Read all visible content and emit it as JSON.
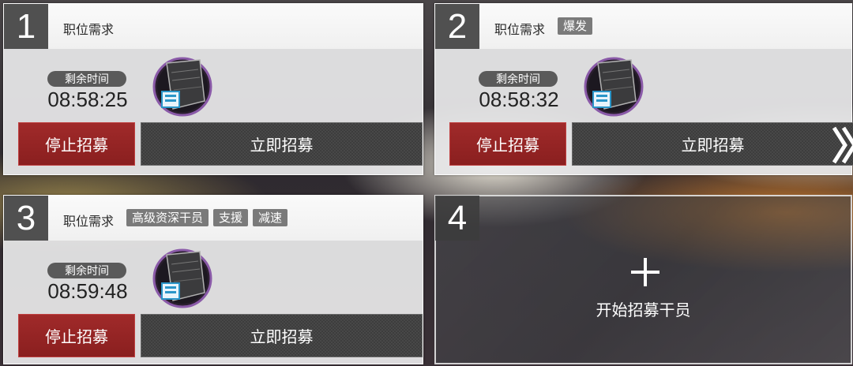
{
  "slots": [
    {
      "number": "1",
      "requirement_label": "职位需求",
      "tags": [],
      "time_label": "剩余时间",
      "time_remaining": "08:58:25",
      "stop_label": "停止招募",
      "instant_label": "立即招募"
    },
    {
      "number": "2",
      "requirement_label": "职位需求",
      "tags": [
        "爆发"
      ],
      "time_label": "剩余时间",
      "time_remaining": "08:58:32",
      "stop_label": "停止招募",
      "instant_label": "立即招募"
    },
    {
      "number": "3",
      "requirement_label": "职位需求",
      "tags": [
        "高级资深干员",
        "支援",
        "减速"
      ],
      "time_label": "剩余时间",
      "time_remaining": "08:59:48",
      "stop_label": "停止招募",
      "instant_label": "立即招募"
    }
  ],
  "empty_slot": {
    "number": "4",
    "start_label": "开始招募干员"
  },
  "colors": {
    "stop_red": "#8a1f1f",
    "instant_dark": "#3d3d3d",
    "number_bg": "#505050"
  }
}
